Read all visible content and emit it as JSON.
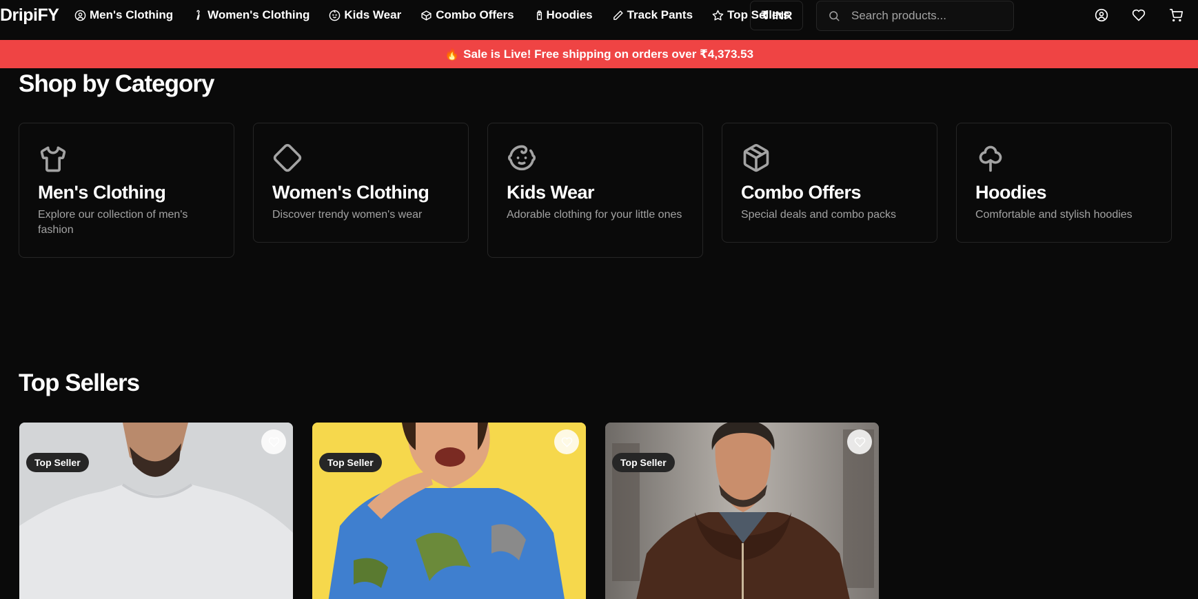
{
  "header": {
    "logo": "DripiFY",
    "nav": [
      {
        "label": "Men's Clothing",
        "icon": "user-circle-icon"
      },
      {
        "label": "Women's Clothing",
        "icon": "hanger-icon"
      },
      {
        "label": "Kids Wear",
        "icon": "baby-face-icon"
      },
      {
        "label": "Combo Offers",
        "icon": "package-icon"
      },
      {
        "label": "Hoodies",
        "icon": "shirt-tag-icon"
      },
      {
        "label": "Track Pants",
        "icon": "pencil-icon"
      },
      {
        "label": "Top Sellers",
        "icon": "star-icon"
      }
    ],
    "currency": "₹ INR",
    "search_placeholder": "Search products...",
    "icons": [
      "account-icon",
      "wishlist-heart-icon",
      "cart-icon"
    ]
  },
  "banner": {
    "text": "Sale is Live! Free shipping on orders over ₹4,373.53",
    "icon": "fire-icon",
    "color": "#ef4444"
  },
  "categories": {
    "title": "Shop by Category",
    "items": [
      {
        "name": "Men's Clothing",
        "desc": "Explore our collection of men's fashion",
        "icon": "tshirt-icon"
      },
      {
        "name": "Women's Clothing",
        "desc": "Discover trendy women's wear",
        "icon": "diamond-icon"
      },
      {
        "name": "Kids Wear",
        "desc": "Adorable clothing for your little ones",
        "icon": "baby-face-icon"
      },
      {
        "name": "Combo Offers",
        "desc": "Special deals and combo packs",
        "icon": "package-icon"
      },
      {
        "name": "Hoodies",
        "desc": "Comfortable and stylish hoodies",
        "icon": "clover-icon"
      }
    ]
  },
  "top_sellers": {
    "title": "Top Sellers",
    "products": [
      {
        "badge": "Top Seller",
        "image": "man-white-tshirt",
        "bg": "#d4d6d8"
      },
      {
        "badge": "Top Seller",
        "image": "kid-dino-hoodie",
        "bg": "#f5d94a"
      },
      {
        "badge": "Top Seller",
        "image": "man-brown-hoodie",
        "bg": "#8a8580"
      }
    ]
  }
}
